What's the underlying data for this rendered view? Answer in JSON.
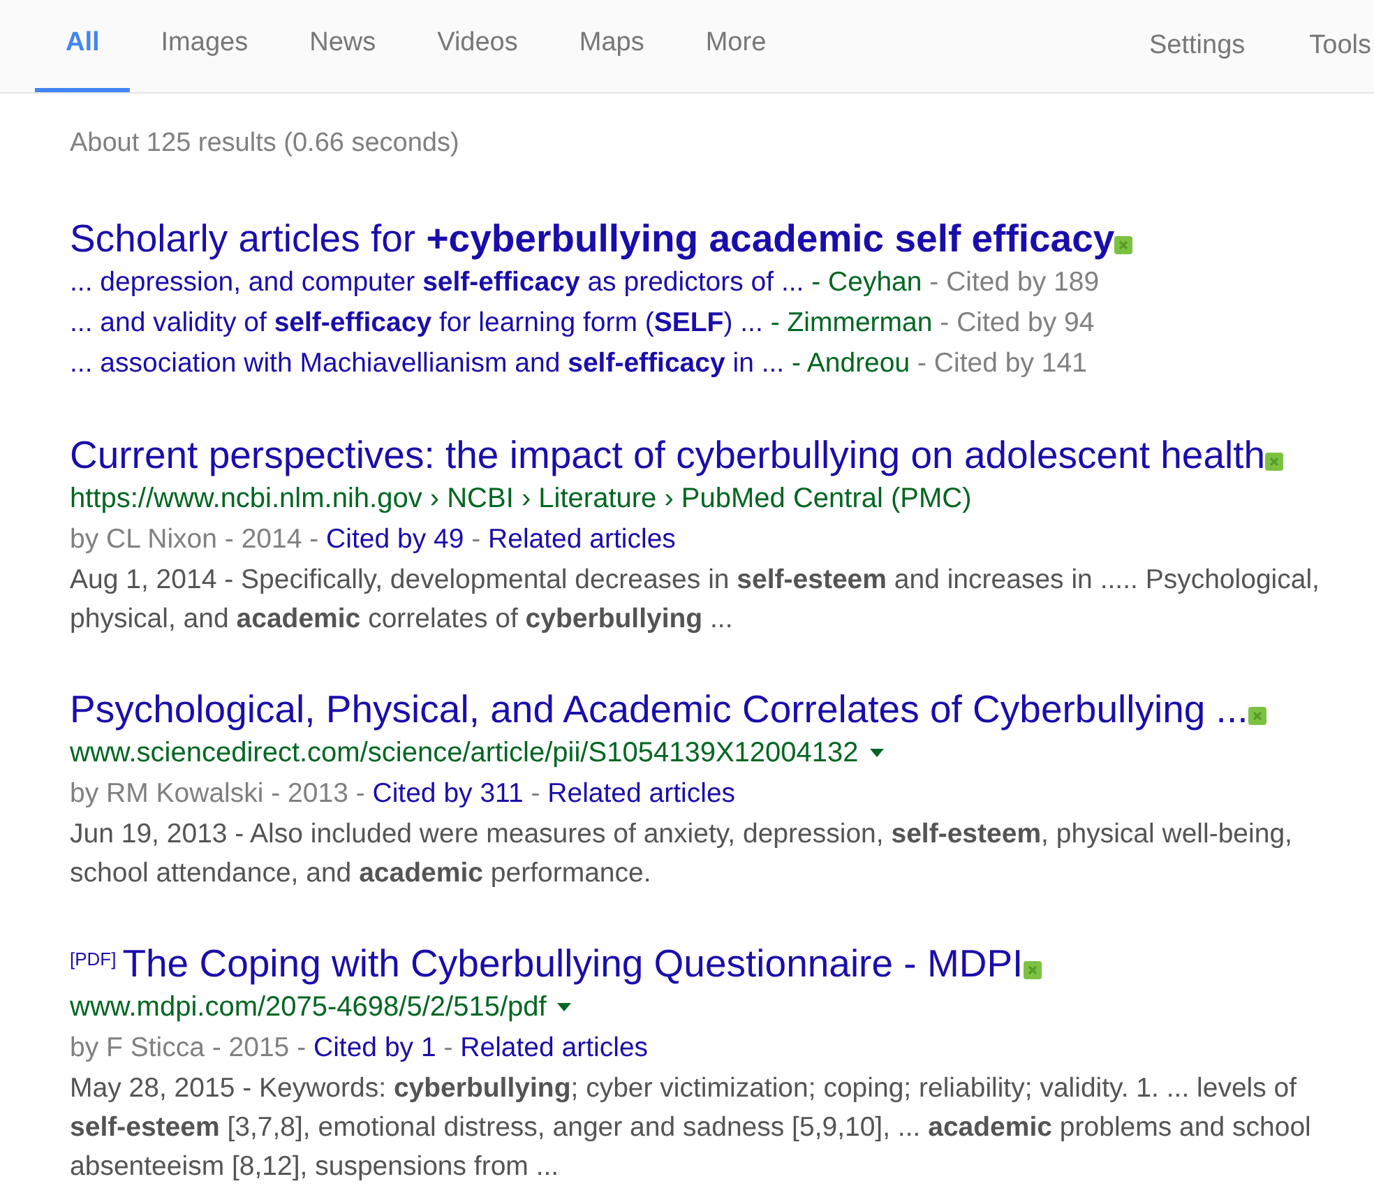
{
  "tabs": [
    {
      "label": "All",
      "selected": true
    },
    {
      "label": "Images",
      "selected": false
    },
    {
      "label": "News",
      "selected": false
    },
    {
      "label": "Videos",
      "selected": false
    },
    {
      "label": "Maps",
      "selected": false
    },
    {
      "label": "More",
      "selected": false
    }
  ],
  "tools": [
    "Settings",
    "Tools"
  ],
  "result_stats": "About 125 results (0.66 seconds)",
  "scholarly": {
    "title": "Scholarly articles for **+cyberbullying academic self efficacy**",
    "lines": [
      {
        "text": "... depression, and computer **self-efficacy** as predictors of ...",
        "author": "- Ceyhan",
        "cited": "- Cited by 189"
      },
      {
        "text": "... and validity of **self-efficacy** for learning form (**SELF**) ...",
        "author": "- Zimmerman",
        "cited": "- Cited by 94"
      },
      {
        "text": "... association with Machiavellianism and **self-efficacy** in ...",
        "author": "- Andreou",
        "cited": "- Cited by 141"
      }
    ]
  },
  "results": [
    {
      "title": "Current perspectives: the impact of cyberbullying on adolescent health",
      "url": "https://www.ncbi.nlm.nih.gov › NCBI › Literature › PubMed Central (PMC)",
      "menu": false,
      "meta": [
        {
          "text": "by CL Nixon - 2014 -",
          "kind": "text"
        },
        {
          "text": "Cited by 49",
          "kind": "link"
        },
        {
          "text": "-",
          "kind": "text"
        },
        {
          "text": "Related articles",
          "kind": "link"
        }
      ],
      "snippet": "Aug 1, 2014 - Specifically, developmental decreases in **self-esteem** and increases in ..... Psychological, physical, and **academic** correlates of **cyberbullying** ..."
    },
    {
      "title": "Psychological, Physical, and Academic Correlates of Cyberbullying ...",
      "url": "www.sciencedirect.com/science/article/pii/S1054139X12004132",
      "menu": true,
      "meta": [
        {
          "text": "by RM Kowalski - 2013 -",
          "kind": "text"
        },
        {
          "text": "Cited by 311",
          "kind": "link"
        },
        {
          "text": "-",
          "kind": "text"
        },
        {
          "text": "Related articles",
          "kind": "link"
        }
      ],
      "snippet": "Jun 19, 2013 - Also included were measures of anxiety, depression, **self-esteem**, physical well-being, school attendance, and **academic** performance."
    },
    {
      "tag": "[PDF]",
      "title": "The Coping with Cyberbullying Questionnaire - MDPI",
      "url": "www.mdpi.com/2075-4698/5/2/515/pdf",
      "menu": true,
      "meta": [
        {
          "text": "by F Sticca - 2015 -",
          "kind": "text"
        },
        {
          "text": "Cited by 1",
          "kind": "link"
        },
        {
          "text": "-",
          "kind": "text"
        },
        {
          "text": "Related articles",
          "kind": "link"
        }
      ],
      "snippet": "May 28, 2015 - Keywords: **cyberbullying**; cyber victimization; coping; reliability; validity. 1. ... levels of **self-esteem** [3,7,8], emotional distress, anger and sadness [5,9,10], ... **academic** problems and school absenteeism [8,12], suspensions from ..."
    }
  ]
}
